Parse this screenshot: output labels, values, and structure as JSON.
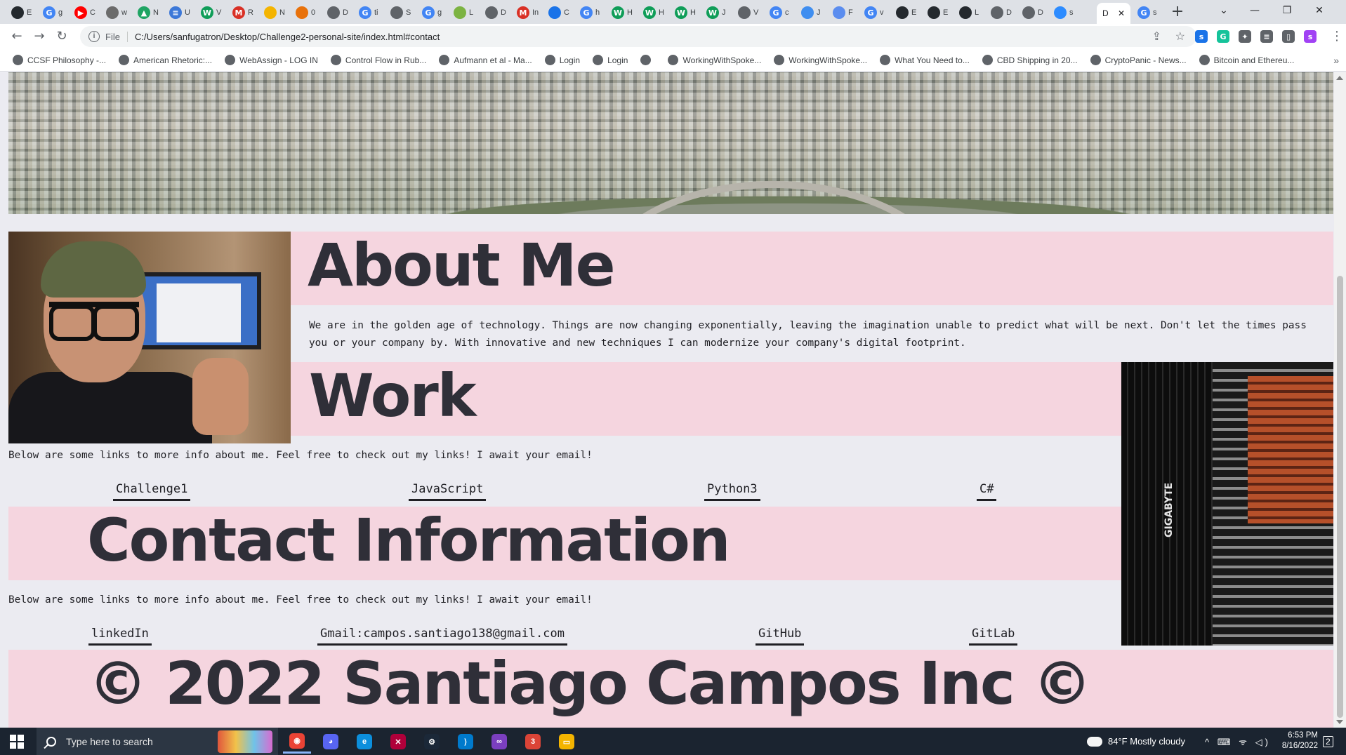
{
  "browser": {
    "tabs_mini": [
      {
        "letter": "E",
        "fav_text": "",
        "fav_color": "#24292e"
      },
      {
        "letter": "g",
        "fav_text": "G",
        "fav_color": "#4285f4"
      },
      {
        "letter": "C",
        "fav_text": "▶",
        "fav_color": "#ff0000"
      },
      {
        "letter": "w",
        "fav_text": "",
        "fav_color": "#6b6b6b"
      },
      {
        "letter": "N",
        "fav_text": "▲",
        "fav_color": "#1fa463"
      },
      {
        "letter": "U",
        "fav_text": "≡",
        "fav_color": "#3c78d8"
      },
      {
        "letter": "V",
        "fav_text": "W",
        "fav_color": "#0f9d58"
      },
      {
        "letter": "R",
        "fav_text": "M",
        "fav_color": "#d93025"
      },
      {
        "letter": "N",
        "fav_text": "",
        "fav_color": "#f4b400"
      },
      {
        "letter": "0",
        "fav_text": "",
        "fav_color": "#e8710a"
      },
      {
        "letter": "D",
        "fav_text": "",
        "fav_color": "#5f6368"
      },
      {
        "letter": "ti",
        "fav_text": "G",
        "fav_color": "#4285f4"
      },
      {
        "letter": "S",
        "fav_text": "",
        "fav_color": "#5f6368"
      },
      {
        "letter": "g",
        "fav_text": "G",
        "fav_color": "#4285f4"
      },
      {
        "letter": "L",
        "fav_text": "",
        "fav_color": "#7cb342"
      },
      {
        "letter": "D",
        "fav_text": "",
        "fav_color": "#5f6368"
      },
      {
        "letter": "In",
        "fav_text": "M",
        "fav_color": "#d93025"
      },
      {
        "letter": "C",
        "fav_text": "",
        "fav_color": "#1a73e8"
      },
      {
        "letter": "h",
        "fav_text": "G",
        "fav_color": "#4285f4"
      },
      {
        "letter": "H",
        "fav_text": "W",
        "fav_color": "#0f9d58"
      },
      {
        "letter": "H",
        "fav_text": "W",
        "fav_color": "#0f9d58"
      },
      {
        "letter": "H",
        "fav_text": "W",
        "fav_color": "#0f9d58"
      },
      {
        "letter": "J",
        "fav_text": "W",
        "fav_color": "#0f9d58"
      },
      {
        "letter": "V",
        "fav_text": "",
        "fav_color": "#5f6368"
      },
      {
        "letter": "c",
        "fav_text": "G",
        "fav_color": "#4285f4"
      },
      {
        "letter": "J",
        "fav_text": "",
        "fav_color": "#3f8ef0"
      },
      {
        "letter": "F",
        "fav_text": "",
        "fav_color": "#5b8def"
      },
      {
        "letter": "v",
        "fav_text": "G",
        "fav_color": "#4285f4"
      },
      {
        "letter": "E",
        "fav_text": "",
        "fav_color": "#24292e"
      },
      {
        "letter": "E",
        "fav_text": "",
        "fav_color": "#24292e"
      },
      {
        "letter": "L",
        "fav_text": "",
        "fav_color": "#24292e"
      },
      {
        "letter": "D",
        "fav_text": "",
        "fav_color": "#5f6368"
      },
      {
        "letter": "D",
        "fav_text": "",
        "fav_color": "#5f6368"
      },
      {
        "letter": "s",
        "fav_text": "",
        "fav_color": "#2d8cff"
      }
    ],
    "active_tab": {
      "title": "D",
      "close": "✕"
    },
    "tab_after": {
      "letter": "s",
      "fav_text": "G",
      "fav_color": "#4285f4"
    },
    "new_tab": "+",
    "window_controls": {
      "dropdown": "⌄",
      "minimize": "—",
      "restore": "❐",
      "close": "✕"
    },
    "nav": {
      "back": "←",
      "forward": "→",
      "reload": "↻"
    },
    "omnibox": {
      "info": "i",
      "scheme": "File",
      "url": "C:/Users/sanfugatron/Desktop/Challenge2-personal-site/index.html#contact"
    },
    "omnibox_icons": {
      "share": "⇪",
      "bookmark_star": "☆"
    },
    "extensions": [
      {
        "name": "s",
        "color": "#1a73e8"
      },
      {
        "name": "G",
        "color": "#15c39a"
      },
      {
        "name": "✦",
        "color": "#5f6368"
      },
      {
        "name": "≡",
        "color": "#5f6368"
      },
      {
        "name": "▯",
        "color": "#5f6368"
      },
      {
        "name": "s",
        "color": "#a142f4"
      }
    ],
    "menu": "⋮",
    "bookmarks": [
      {
        "label": "CCSF Philosophy -..."
      },
      {
        "label": "American Rhetoric:..."
      },
      {
        "label": "WebAssign - LOG IN"
      },
      {
        "label": "Control Flow in Rub..."
      },
      {
        "label": "Aufmann et al - Ma..."
      },
      {
        "label": "Login"
      },
      {
        "label": "Login"
      },
      {
        "label": ""
      },
      {
        "label": "WorkingWithSpoke..."
      },
      {
        "label": "WorkingWithSpoke..."
      },
      {
        "label": "What You Need to..."
      },
      {
        "label": "CBD Shipping in 20..."
      },
      {
        "label": "CryptoPanic - News..."
      },
      {
        "label": "Bitcoin and Ethereu..."
      }
    ],
    "bookmarks_more": "»"
  },
  "page": {
    "about": {
      "heading": "About Me",
      "text": "We are in the golden age of technology. Things are now changing exponentially, leaving the imagination unable to predict what will be next. Don't let the times pass you or your company by. With innovative and new techniques I can modernize your company's digital footprint."
    },
    "work": {
      "heading": "Work",
      "text": "Below are some links to more info about me. Feel free to check out my links! I await your email!",
      "links": [
        "Challenge1",
        "JavaScript",
        "Python3",
        "C#"
      ]
    },
    "contact": {
      "heading": "Contact Information",
      "text": "Below are some links to more info about me. Feel free to check out my links! I await your email!",
      "links": [
        "linkedIn",
        "Gmail:campos.santiago138@gmail.com",
        "GitHub",
        "GitLab"
      ]
    },
    "footer": {
      "text": "© 2022 Santiago Campos Inc ©"
    },
    "circuit_label": "GIGABYTE"
  },
  "taskbar": {
    "search_placeholder": "Type here to search",
    "apps": [
      {
        "name": "chrome",
        "glyph": "◉",
        "color": "#ea4335"
      },
      {
        "name": "discord",
        "glyph": "◕",
        "color": "#5865f2"
      },
      {
        "name": "edge",
        "glyph": "e",
        "color": "#0c8fdc"
      },
      {
        "name": "app",
        "glyph": "✕",
        "color": "#b0003a"
      },
      {
        "name": "steam",
        "glyph": "⚙",
        "color": "#1b2838"
      },
      {
        "name": "vscode",
        "glyph": "⟩",
        "color": "#007acc"
      },
      {
        "name": "visual-studio",
        "glyph": "∞",
        "color": "#7b3fbf"
      },
      {
        "name": "chrome-profile",
        "glyph": "3",
        "color": "#db4437"
      },
      {
        "name": "file-explorer",
        "glyph": "▭",
        "color": "#f4b400"
      }
    ],
    "weather": {
      "temp": "84°F",
      "desc": "Mostly cloudy"
    },
    "tray_icons": "^ ⌨ ᯤ ◁)",
    "time": "6:53 PM",
    "date": "8/16/2022",
    "notifications": "2"
  }
}
